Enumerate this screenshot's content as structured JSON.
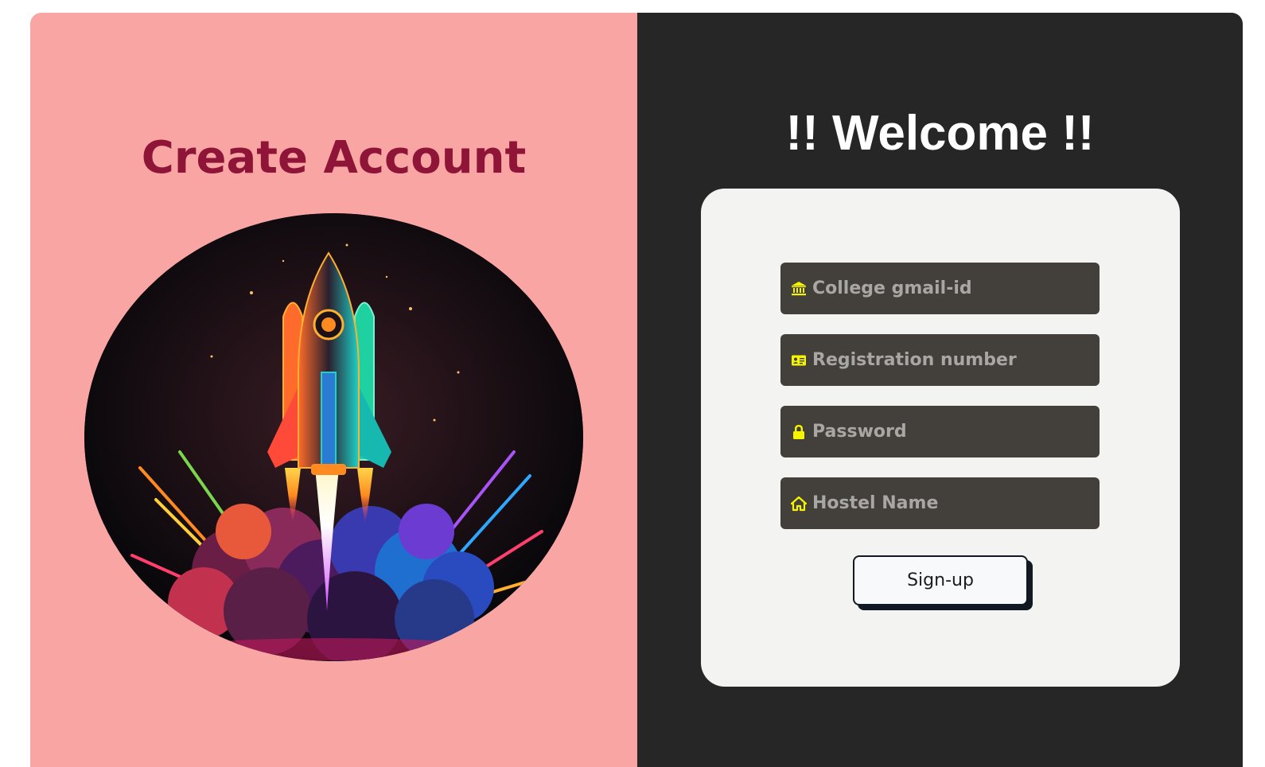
{
  "left": {
    "title": "Create Account",
    "illustration": "rocket-launch-illustration"
  },
  "right": {
    "title": "!! Welcome !!",
    "form": {
      "fields": [
        {
          "placeholder": "College gmail-id",
          "icon": "institution-icon"
        },
        {
          "placeholder": "Registration number",
          "icon": "id-card-icon"
        },
        {
          "placeholder": "Password",
          "icon": "lock-icon"
        },
        {
          "placeholder": "Hostel Name",
          "icon": "home-icon"
        }
      ],
      "submit_label": "Sign-up"
    }
  },
  "colors": {
    "left_bg": "#f9a5a4",
    "title_color": "#8e1538",
    "right_bg": "#262626",
    "card_bg": "#f3f3f2",
    "field_bg": "#433f3b",
    "icon_color": "#f5f500"
  }
}
